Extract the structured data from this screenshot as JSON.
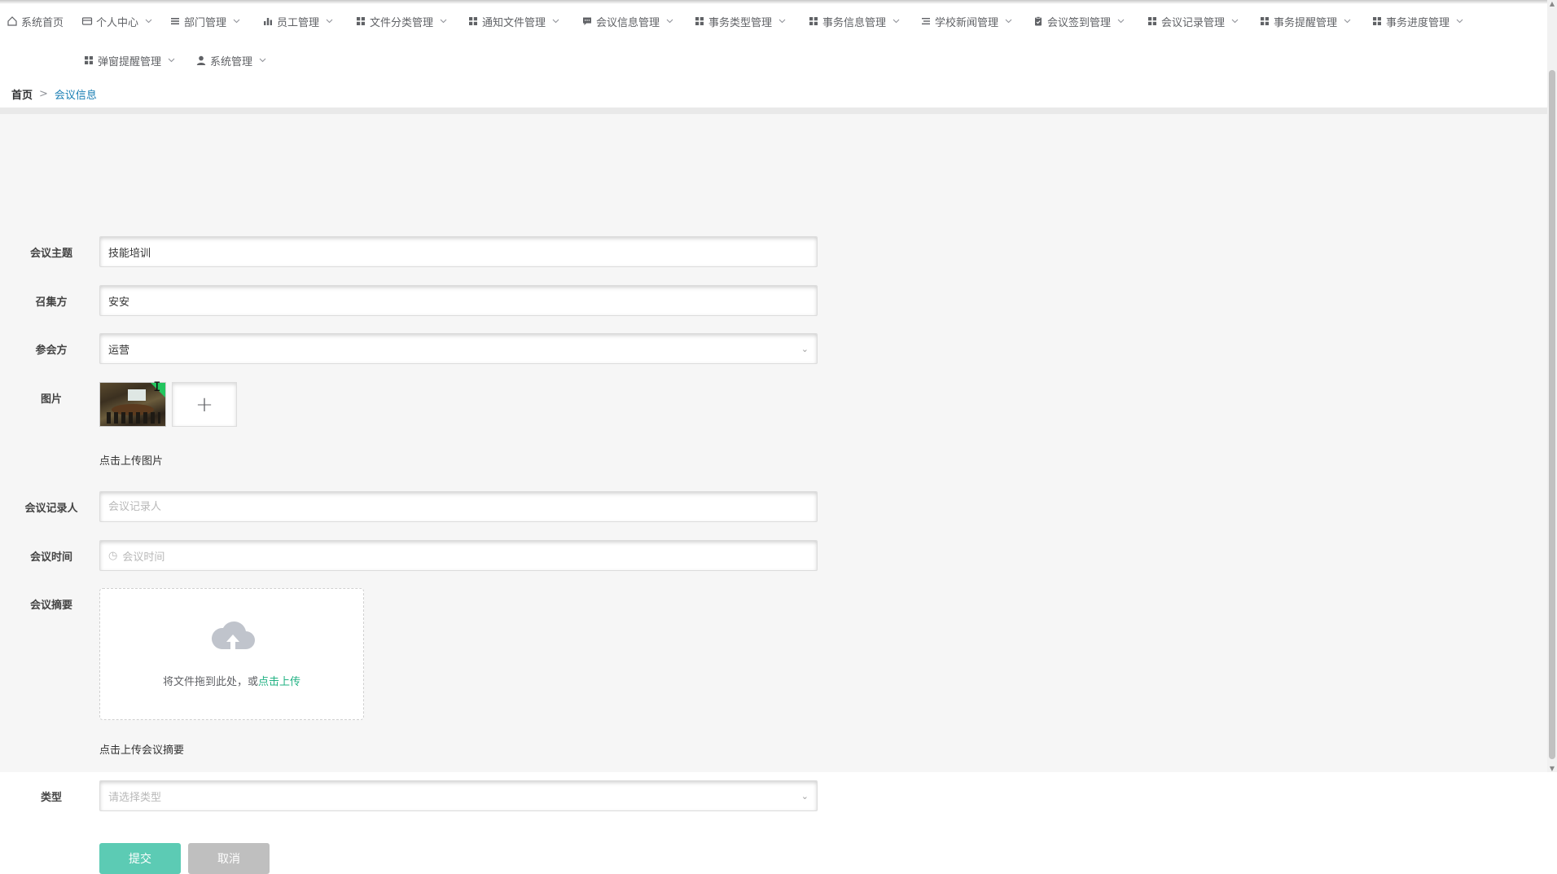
{
  "nav": {
    "items": [
      {
        "label": "系统首页",
        "icon": "home-icon",
        "chevron": false
      },
      {
        "label": "个人中心",
        "icon": "card-icon",
        "chevron": true
      },
      {
        "label": "部门管理",
        "icon": "list-icon",
        "chevron": true
      },
      {
        "label": "员工管理",
        "icon": "bar-chart-icon",
        "chevron": true
      },
      {
        "label": "文件分类管理",
        "icon": "grid-icon",
        "chevron": true
      },
      {
        "label": "通知文件管理",
        "icon": "grid-icon",
        "chevron": true
      },
      {
        "label": "会议信息管理",
        "icon": "comment-icon",
        "chevron": true
      },
      {
        "label": "事务类型管理",
        "icon": "grid-icon",
        "chevron": true
      },
      {
        "label": "事务信息管理",
        "icon": "grid-icon",
        "chevron": true
      },
      {
        "label": "学校新闻管理",
        "icon": "menu-icon",
        "chevron": true
      },
      {
        "label": "会议签到管理",
        "icon": "clipboard-icon",
        "chevron": true
      },
      {
        "label": "会议记录管理",
        "icon": "grid-icon",
        "chevron": true
      },
      {
        "label": "事务提醒管理",
        "icon": "grid-icon",
        "chevron": true
      },
      {
        "label": "事务进度管理",
        "icon": "grid-icon",
        "chevron": true
      },
      {
        "label": "弹窗提醒管理",
        "icon": "grid-icon",
        "chevron": true
      },
      {
        "label": "系统管理",
        "icon": "user-icon",
        "chevron": true
      }
    ]
  },
  "breadcrumb": {
    "home": "首页",
    "separator": ">",
    "current": "会议信息"
  },
  "form": {
    "topic": {
      "label": "会议主题",
      "value": "技能培训"
    },
    "convener": {
      "label": "召集方",
      "value": "安安"
    },
    "participant": {
      "label": "参会方",
      "value": "运营"
    },
    "image": {
      "label": "图片",
      "add_symbol": "+",
      "hint": "点击上传图片"
    },
    "recorder": {
      "label": "会议记录人",
      "value": "",
      "placeholder": "会议记录人"
    },
    "time": {
      "label": "会议时间",
      "value": "",
      "placeholder": "会议时间"
    },
    "summary": {
      "label": "会议摘要",
      "drop_text": "将文件拖到此处，或",
      "drop_link": "点击上传",
      "hint": "点击上传会议摘要"
    },
    "type": {
      "label": "类型",
      "placeholder": "请选择类型"
    },
    "submit_label": "提交",
    "cancel_label": "取消"
  },
  "colors": {
    "accent": "#5ccbb4",
    "link": "#1b7fb4",
    "upload_link": "#21b283",
    "cancel": "#bfbfbf"
  }
}
